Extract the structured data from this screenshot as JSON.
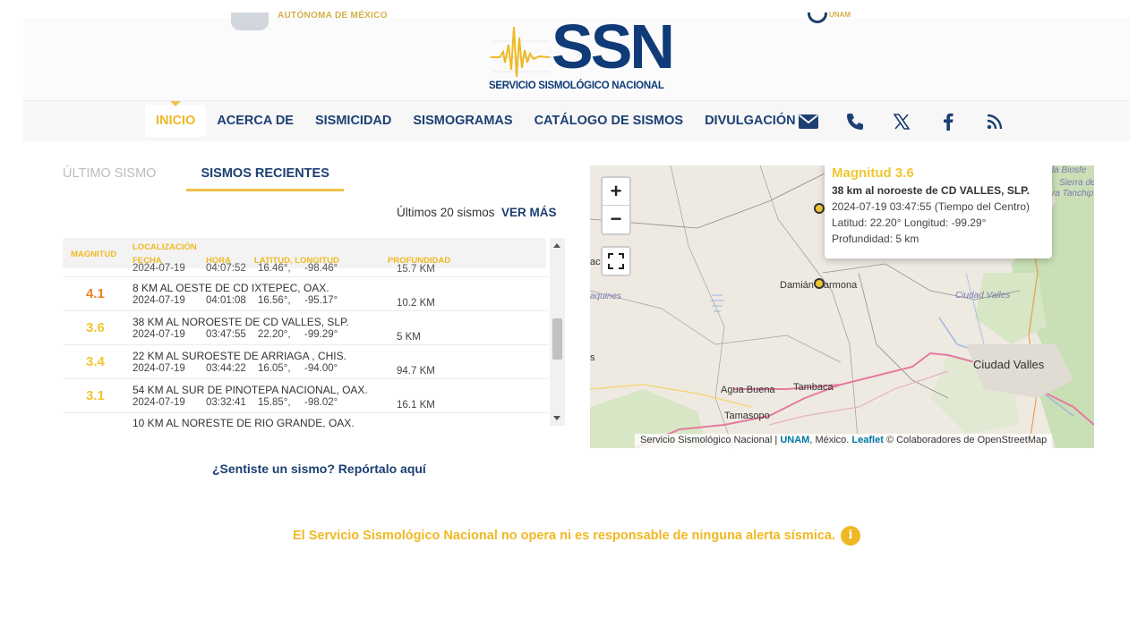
{
  "header": {
    "unam_text": "AUTÓNOMA DE MÉXICO",
    "right_logo_text": "UNAM",
    "ssn_logo_word": "SSN",
    "ssn_logo_subtitle": "SERVICIO SISMOLÓGICO NACIONAL"
  },
  "nav": {
    "items": [
      {
        "label": "INICIO",
        "active": true
      },
      {
        "label": "ACERCA DE",
        "active": false
      },
      {
        "label": "SISMICIDAD",
        "active": false
      },
      {
        "label": "SISMOGRAMAS",
        "active": false
      },
      {
        "label": "CATÁLOGO DE SISMOS",
        "active": false
      },
      {
        "label": "DIVULGACIÓN",
        "active": false
      }
    ],
    "social_icons": [
      "mail-icon",
      "phone-icon",
      "x-icon",
      "facebook-icon",
      "rss-icon"
    ]
  },
  "tabs": {
    "ultimo": "ÚLTIMO SISMO",
    "recientes": "SISMOS RECIENTES"
  },
  "list_header": {
    "count_text": "Últimos 20 sismos",
    "ver_mas": "VER MÁS"
  },
  "table": {
    "headers": {
      "magnitud": "MAGNITUD",
      "localizacion": "LOCALIZACIÓN",
      "fecha": "FECHA",
      "hora": "HORA",
      "latlon": "LATITUD, LONGITUD",
      "profundidad": "PROFUNDIDAD"
    },
    "partial_top": {
      "date": "2024-07-19",
      "time": "04:07:52",
      "lat": "16.46°,",
      "lon": "-98.46°",
      "depth": "15.7 KM"
    },
    "rows": [
      {
        "mag": "4.1",
        "color": "#e8862a",
        "loc": "8 KM AL OESTE DE CD IXTEPEC, OAX.",
        "date": "2024-07-19",
        "time": "04:01:08",
        "lat": "16.56°,",
        "lon": "-95.17°",
        "depth": "10.2 KM"
      },
      {
        "mag": "3.6",
        "color": "#f0c633",
        "loc": "38 KM AL NOROESTE DE CD VALLES, SLP.",
        "date": "2024-07-19",
        "time": "03:47:55",
        "lat": "22.20°,",
        "lon": "-99.29°",
        "depth": "5 KM"
      },
      {
        "mag": "3.4",
        "color": "#f0c633",
        "loc": "22 KM AL SUROESTE DE ARRIAGA , CHIS.",
        "date": "2024-07-19",
        "time": "03:44:22",
        "lat": "16.05°,",
        "lon": "-94.00°",
        "depth": "94.7 KM"
      },
      {
        "mag": "3.1",
        "color": "#f0c633",
        "loc": "54 KM AL SUR DE PINOTEPA NACIONAL, OAX.",
        "date": "2024-07-19",
        "time": "03:32:41",
        "lat": "15.85°,",
        "lon": "-98.02°",
        "depth": "16.1 KM"
      }
    ],
    "partial_bottom": {
      "loc": "10 KM AL NORESTE DE RIO GRANDE, OAX."
    }
  },
  "report_link": "¿Sentiste un sismo? Repórtalo aquí",
  "disclaimer": "El Servicio Sismológico Nacional no opera ni es responsable de ninguna alerta sísmica.",
  "map": {
    "zoom_in": "+",
    "zoom_out": "−",
    "popup": {
      "title": "Magnitud 3.6",
      "location": "38 km al noroeste de CD VALLES, SLP.",
      "datetime": "2024-07-19  03:47:55 (Tiempo del Centro)",
      "coords": "Latitud: 22.20°  Longitud: -99.29°",
      "depth": "Profundidad: 5 km"
    },
    "labels": {
      "damian": "Damián Carmona",
      "ciudad_valles_it": "Ciudad Valles",
      "ciudad_valles": "Ciudad Valles",
      "agua_buena": "Agua Buena",
      "tambaca": "Tambaca",
      "tamasopo": "Tamasopo",
      "aquines": "aquines",
      "ac": "ac",
      "s": "s",
      "biosfera": "la Biosfe",
      "sierra": "Sierra del",
      "tanchip": "ra Tanchip"
    },
    "attribution": {
      "ssn": "Servicio Sismológico Nacional",
      "sep": "|",
      "unam": "UNAM",
      "mexico": ", México.",
      "leaflet": "Leaflet",
      "osm": "© Colaboradores de OpenStreetMap"
    }
  }
}
